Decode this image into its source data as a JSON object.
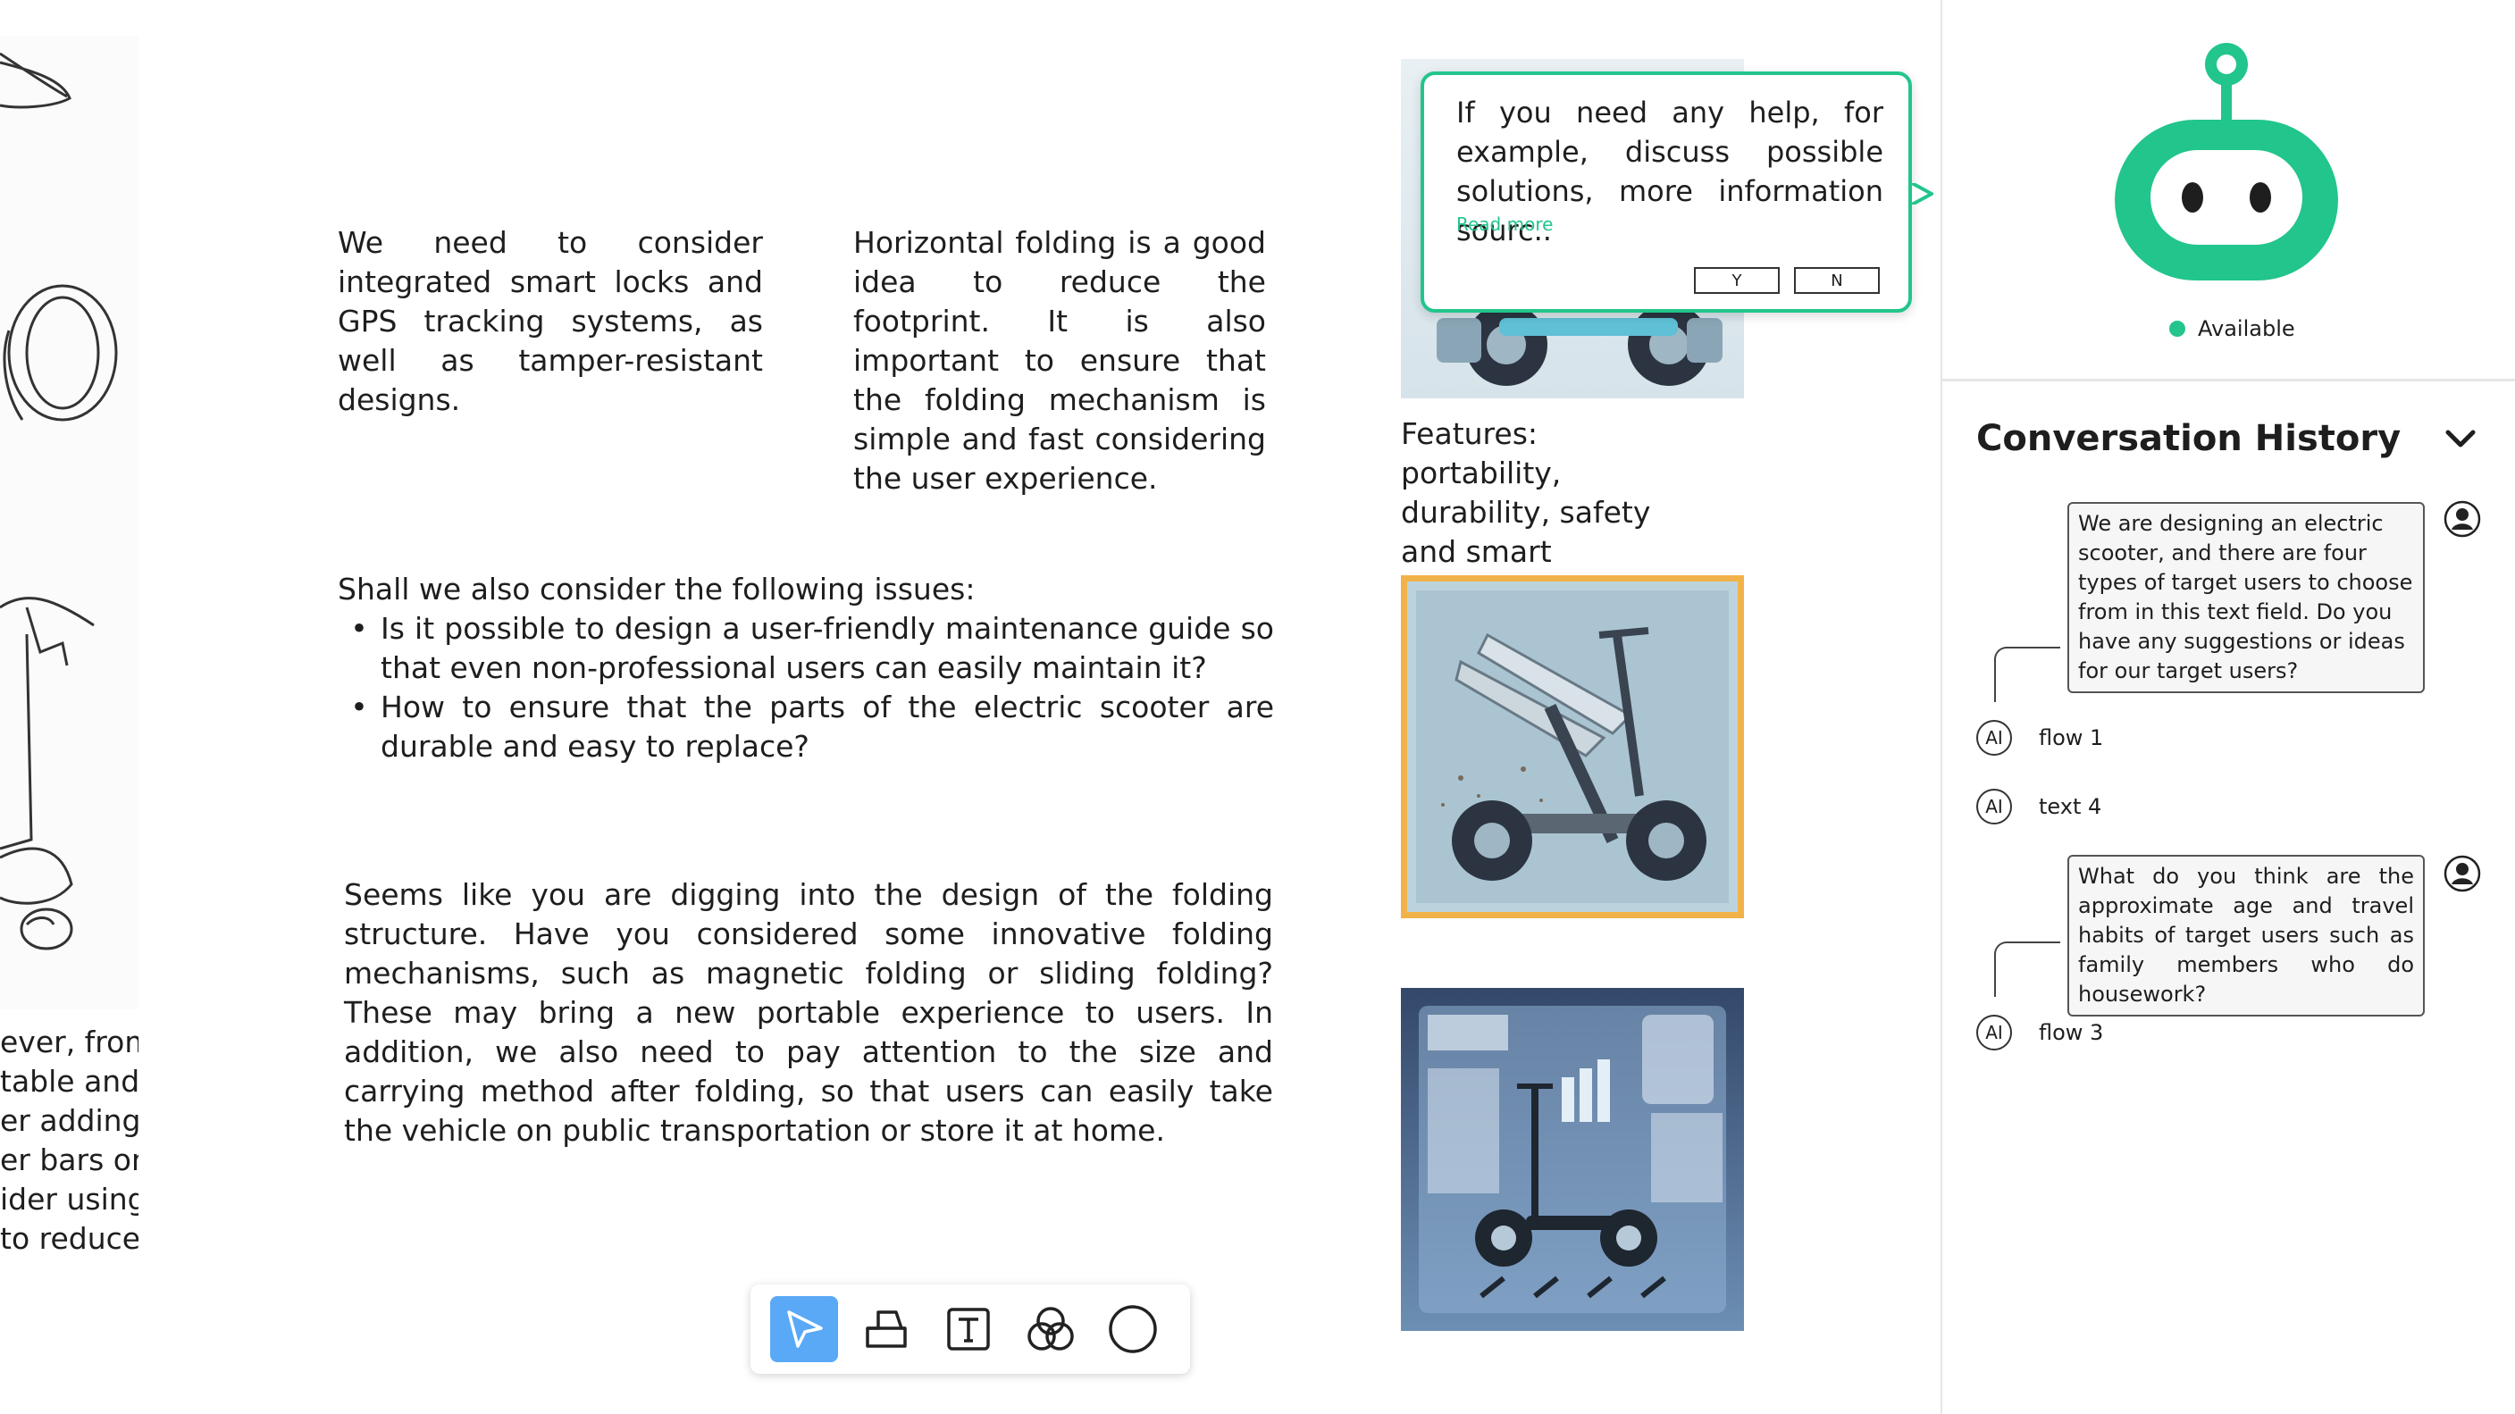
{
  "canvas": {
    "left_cut_text": [
      "ever, from",
      "table and",
      "er adding",
      "er bars or",
      "ider using",
      "to  reduce"
    ],
    "notes": {
      "smart_locks": "We need to consider integrated smart locks and GPS tracking systems, as well as tamper-resistant designs.",
      "horizontal_folding": "Horizontal folding is a good idea to reduce the footprint. It is also important to ensure that the folding mechanism is simple and fast considering the user experience.",
      "issues_intro": "Shall we also consider the following issues:",
      "issues": [
        "Is it possible to design a user-friendly maintenance guide so that even non-professional users can easily maintain it?",
        "How to ensure that the parts of the electric scooter are durable and easy to replace?"
      ],
      "folding_structure": "Seems like you are digging into the design of the folding structure. Have you considered some innovative folding mechanisms, such as magnetic folding or sliding folding? These may bring a new portable experience to users. In addition, we also need to pay attention to the size and carrying method after folding, so that users can easily take the vehicle on public transportation or store it at home.",
      "features": "Features: portability, durability, safety and smart technology"
    },
    "selected_border_color": "#f2b24a"
  },
  "popup": {
    "message": "If you need any help, for example, discuss possible solutions, more information sourc..",
    "read_more": "Read more",
    "yes": "Y",
    "no": "N",
    "accent": "#22c58b"
  },
  "toolbar": {
    "tools": [
      "select-arrow-icon",
      "shape-icon",
      "text-tool-icon",
      "overlap-circles-icon",
      "circle-icon"
    ],
    "active": "select-arrow-icon",
    "active_color": "#5aa9f6"
  },
  "assistant": {
    "status": "Available",
    "status_color": "#22c58b",
    "history_title": "Conversation History",
    "messages": [
      {
        "role": "user",
        "text": "We are designing an electric scooter, and there are four types of target users to choose from in this text field. Do you have any suggestions or ideas for our target users?"
      },
      {
        "role": "ai",
        "badge": "AI",
        "text": "flow 1"
      },
      {
        "role": "ai",
        "badge": "AI",
        "text": "text 4"
      },
      {
        "role": "user",
        "text": "What do you think are the approximate age and travel habits of target users such as family members who do housework?"
      },
      {
        "role": "ai",
        "badge": "AI",
        "text": "flow 3"
      }
    ]
  }
}
